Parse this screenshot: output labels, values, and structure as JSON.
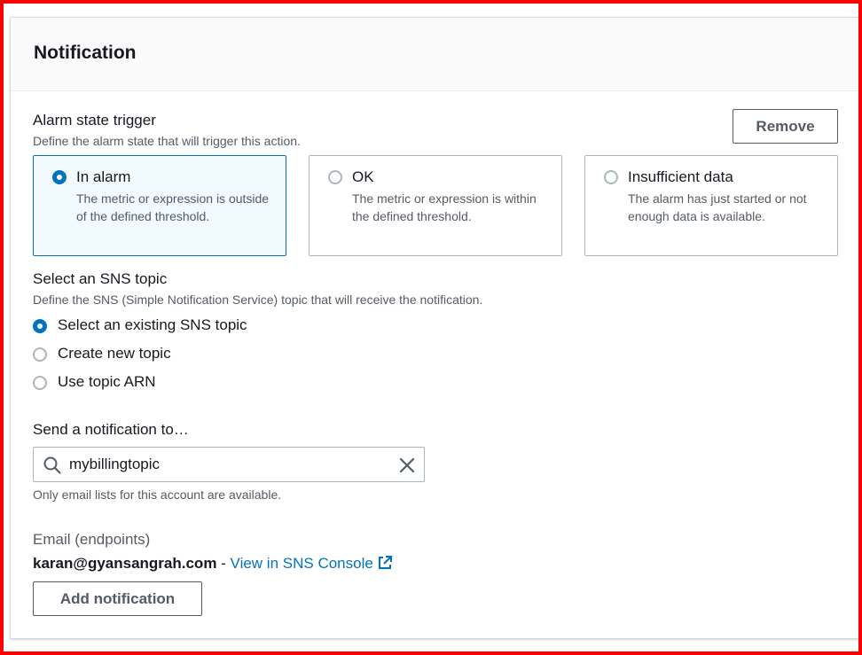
{
  "panel": {
    "title": "Notification"
  },
  "alarm_state": {
    "label": "Alarm state trigger",
    "description": "Define the alarm state that will trigger this action.",
    "remove_label": "Remove",
    "options": [
      {
        "label": "In alarm",
        "description": "The metric or expression is outside of the defined threshold.",
        "selected": true
      },
      {
        "label": "OK",
        "description": "The metric or expression is within the defined threshold.",
        "selected": false
      },
      {
        "label": "Insufficient data",
        "description": "The alarm has just started or not enough data is available.",
        "selected": false
      }
    ]
  },
  "sns_topic": {
    "label": "Select an SNS topic",
    "description": "Define the SNS (Simple Notification Service) topic that will receive the notification.",
    "options": [
      {
        "label": "Select an existing SNS topic",
        "selected": true
      },
      {
        "label": "Create new topic",
        "selected": false
      },
      {
        "label": "Use topic ARN",
        "selected": false
      }
    ]
  },
  "send_to": {
    "label": "Send a notification to…",
    "value": "mybillingtopic",
    "hint": "Only email lists for this account are available."
  },
  "endpoints": {
    "label": "Email (endpoints)",
    "email": "karan@gyansangrah.com",
    "separator": " - ",
    "console_link": "View in SNS Console"
  },
  "add_notification_label": "Add notification",
  "colors": {
    "accent": "#0073bb",
    "frame": "#ff0000",
    "text": "#16191f",
    "secondary_text": "#545b64"
  },
  "icons": {
    "search": "search-icon",
    "clear": "close-icon",
    "external": "external-link-icon"
  }
}
